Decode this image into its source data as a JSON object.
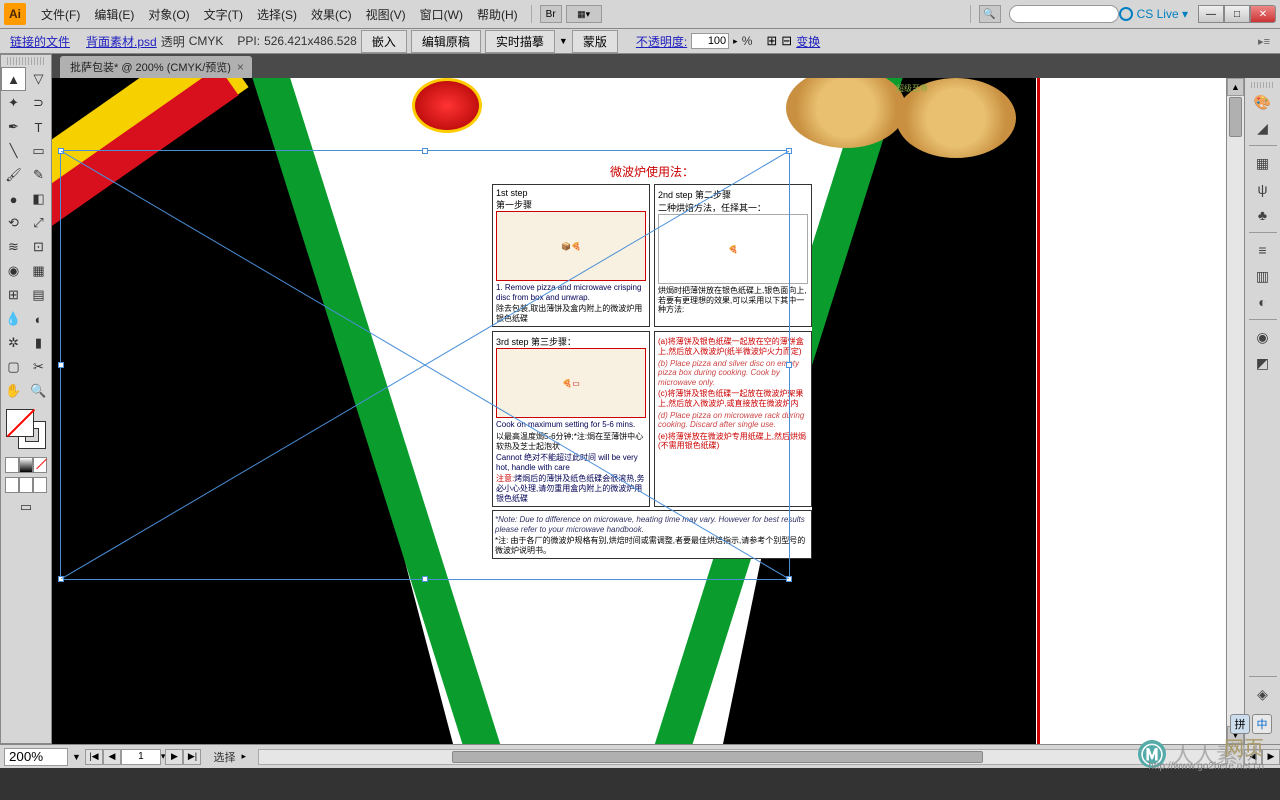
{
  "app": {
    "logo": "Ai"
  },
  "menu": {
    "file": "文件(F)",
    "edit": "编辑(E)",
    "object": "对象(O)",
    "type": "文字(T)",
    "select": "选择(S)",
    "effect": "效果(C)",
    "view": "视图(V)",
    "window": "窗口(W)",
    "help": "帮助(H)",
    "br": "Br",
    "cslive": "CS Live ▾"
  },
  "ctrl": {
    "linked_file": "链接的文件",
    "filename": "背面素材.psd",
    "transparency": "透明",
    "mode": "CMYK",
    "ppi_label": "PPI:",
    "ppi_value": "526.421x486.528",
    "embed": "嵌入",
    "edit_orig": "编辑原稿",
    "live_trace": "实时描摹",
    "mask": "蒙版",
    "opacity_label": "不透明度:",
    "opacity_value": "100",
    "percent": "%",
    "transform": "变换"
  },
  "tab": {
    "title": "批萨包装* @ 200% (CMYK/预览)"
  },
  "canvas": {
    "instructions_title": "微波炉使用法：",
    "step1_label": "1st step",
    "step1_cn": "第一步骤",
    "step2_label": "2nd step 第二步骤",
    "step2_cn": "二种烘焙方法，任择其一：",
    "step3_label": "3rd step 第三步骤：",
    "text1": "1. Remove pizza and microwave crisping disc from box and unwrap.",
    "text1_cn": "除去包装,取出薄饼及盒内附上的微波炉用银色纸碟",
    "text2_cn": "烘焗时把薄饼放在银色纸碟上,银色面向上,若要有更理想的效果,可以采用以下其中一种方法:",
    "text3_en": "Cook on maximum setting for 5-6 mins.",
    "text3_cn": "以最高温度焗5-6分钟;*注:焗在至薄饼中心软热及芝士起泡状",
    "text3b_cn": "Cannot 绝对不能超过此时间 will be very hot, handle with care",
    "warn_label": "注意:",
    "warn_cn": "烤焗后的薄饼及纸色纸碟会很滚热,务必小心处理,请勿重用盒内附上的微波炉用银色纸碟",
    "optA": "(a)将薄饼及银色纸碟一起放在空的薄饼盒上,然后放入微波炉(纸半微波炉火力而定)",
    "optB": "(b) Place pizza and silver disc on empty pizza box during cooking. Cook by microwave only.",
    "optC": "(c)将薄饼及银色纸碟一起放在微波炉架果上,然后放入微波炉,或直接放在微波炉内",
    "optD": "(d) Place pizza on microwave rack during cooking. Discard after single use.",
    "optE": "(e)将薄饼放在微波炉专用纸碟上,然后烘焗 (不需用银色纸碟)",
    "footer_en": "*Note: Due to difference on microwave, heating time may vary. However for best results please refer to your microwave handbook.",
    "footer_cn": "*注: 由于各厂的微波炉规格有别,烘焙时间或需调整,者要最佳烘焙指示,请参考个别型号的微波炉说明书。",
    "pizza_label": "超级至尊"
  },
  "status": {
    "zoom": "200%",
    "page": "1",
    "tool_label": "选择",
    "nav_first": "|◀",
    "nav_prev": "◀",
    "nav_next": "▶",
    "nav_last": "▶|"
  },
  "ime": {
    "btn1": "拼",
    "btn2": "中"
  },
  "watermark": {
    "text": "人人素材",
    "site": "网页",
    "url": "http://www.go2here.net.cn"
  }
}
